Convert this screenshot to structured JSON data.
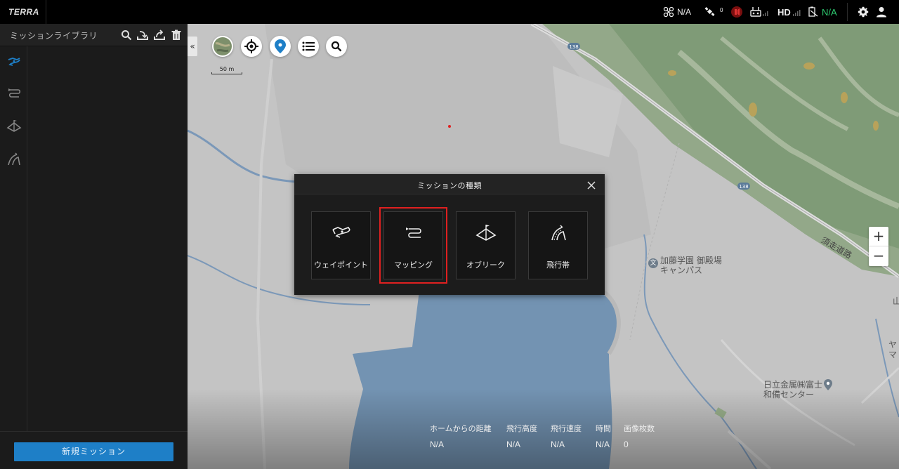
{
  "app": {
    "brand": "TERRA"
  },
  "status": {
    "drone": "N/A",
    "gps_count": "0",
    "hd": "HD",
    "battery": "N/A",
    "accent_green": "#2ecc71"
  },
  "sidebar": {
    "title": "ミッションライブラリ",
    "tools": [
      "search-icon",
      "import-icon",
      "export-icon",
      "trash-icon"
    ],
    "rail": [
      "waypoint-mission-icon",
      "mapping-mission-icon",
      "oblique-mission-icon",
      "corridor-mission-icon"
    ],
    "new_mission": "新規ミッション",
    "accent": "#1e7fc7"
  },
  "map": {
    "collapse": "«",
    "scale": "50 m",
    "zoom_in": "+",
    "zoom_out": "−",
    "road_138_a": "138",
    "road_138_b": "138",
    "road_name": "須走道路",
    "poi_campus": "加藤学園 御殿場\nキャンパス",
    "poi_hitachi": "日立金属㈱富士\n和備センター",
    "poi_edge_1": "山",
    "poi_edge_2": "ヤマ",
    "poi_campus_symbol": "文"
  },
  "telemetry": [
    {
      "label": "ホームからの距離",
      "value": "N/A"
    },
    {
      "label": "飛行高度",
      "value": "N/A"
    },
    {
      "label": "飛行速度",
      "value": "N/A"
    },
    {
      "label": "時間",
      "value": "N/A"
    },
    {
      "label": "画像枚数",
      "value": "0"
    }
  ],
  "modal": {
    "title": "ミッションの種類",
    "close": "close-icon",
    "options": [
      {
        "label": "ウェイポイント",
        "icon": "waypoint-icon",
        "selected": false
      },
      {
        "label": "マッピング",
        "icon": "mapping-icon",
        "selected": true
      },
      {
        "label": "オブリーク",
        "icon": "oblique-icon",
        "selected": false
      },
      {
        "label": "飛行帯",
        "icon": "corridor-icon",
        "selected": false
      }
    ],
    "highlight_color": "#e02020"
  }
}
